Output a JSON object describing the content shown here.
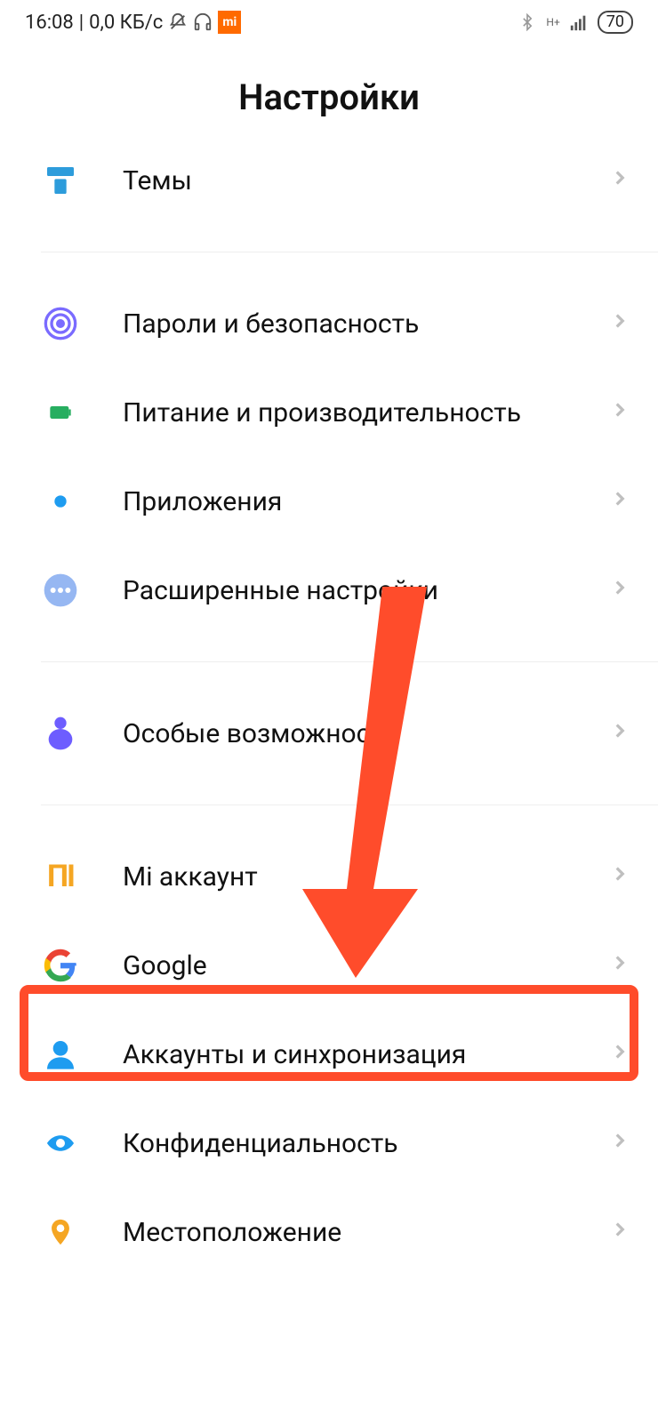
{
  "status": {
    "time": "16:08",
    "speed": "0,0 КБ/с",
    "battery": "70"
  },
  "title": "Настройки",
  "items": {
    "themes": {
      "label": "Темы"
    },
    "security": {
      "label": "Пароли и безопасность"
    },
    "battery": {
      "label": "Питание и производительность"
    },
    "apps": {
      "label": "Приложения"
    },
    "advanced": {
      "label": "Расширенные настройки"
    },
    "accessibility": {
      "label": "Особые возможности"
    },
    "mi_account": {
      "label": "Mi аккаунт"
    },
    "google": {
      "label": "Google"
    },
    "accounts": {
      "label": "Аккаунты и синхронизация"
    },
    "privacy": {
      "label": "Конфиденциальность"
    },
    "location": {
      "label": "Местоположение"
    }
  }
}
